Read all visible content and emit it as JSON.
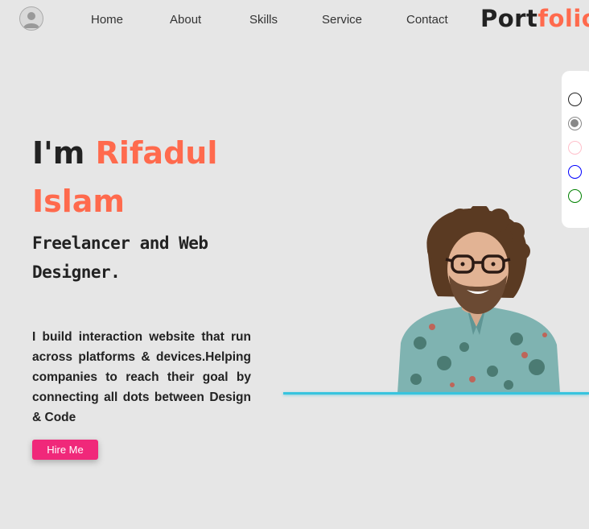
{
  "nav": {
    "avatar_icon": "user-avatar-icon",
    "links": [
      "Home",
      "About",
      "Skills",
      "Service",
      "Contact"
    ],
    "logo_part1": "Port",
    "logo_part2": "folio"
  },
  "theme": {
    "colors": [
      "#222222",
      "#888888",
      "#ffc0cb",
      "#0000ff",
      "#008000"
    ]
  },
  "hero": {
    "greeting": "I'm ",
    "name_first": "Rifadul",
    "name_last": "Islam",
    "subtitle": "Freelancer and Web Designer.",
    "intro": "I build interaction website that run across platforms & devices.Helping companies to reach their goal by connecting all dots between Design & Code",
    "hire_label": "Hire Me"
  },
  "colors": {
    "accent": "#ff6a4d",
    "button": "#f0287a",
    "underline": "#37c4de",
    "background": "#e6e6e6"
  }
}
